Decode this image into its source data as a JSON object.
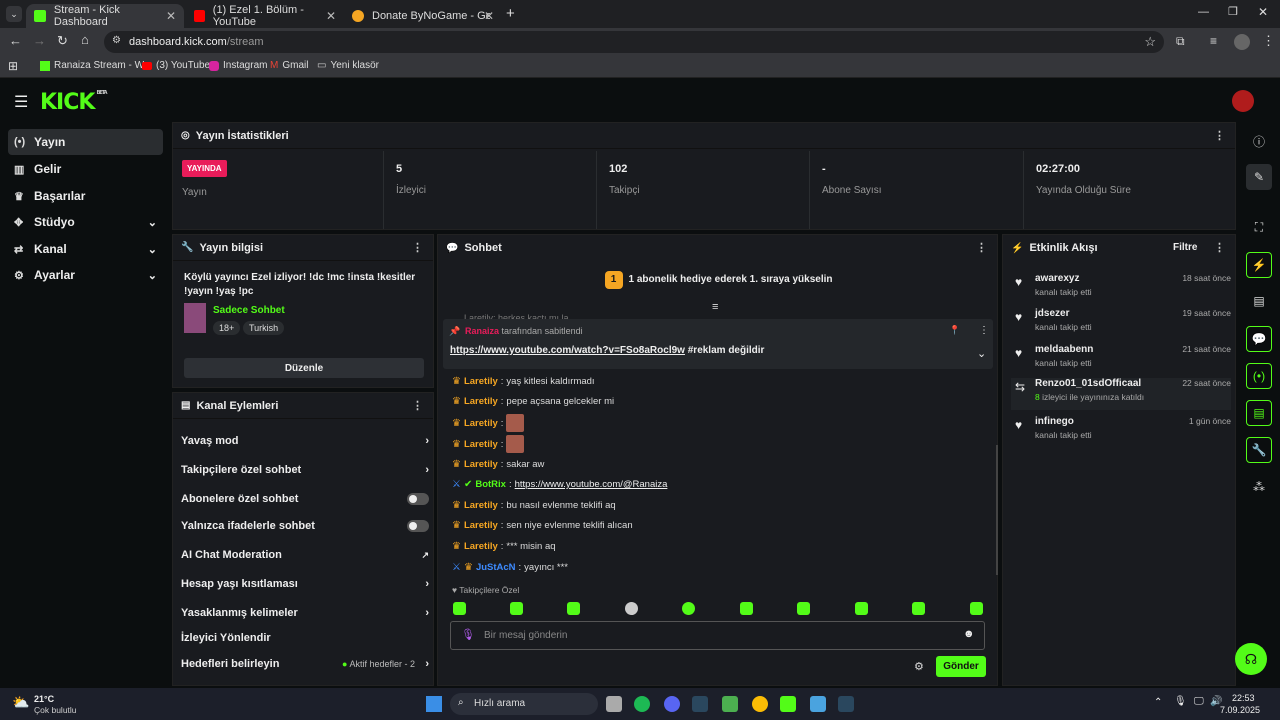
{
  "browser": {
    "tabs": [
      {
        "label": "Stream - Kick Dashboard",
        "active": true
      },
      {
        "label": "(1) Ezel 1. Bölüm - YouTube",
        "active": false
      },
      {
        "label": "Donate ByNoGame - Gelen/Gi",
        "active": false
      }
    ],
    "url_host": "dashboard.kick.com",
    "url_path": "/stream",
    "bookmarks": [
      "Ranaiza Stream - W...",
      "(3) YouTube",
      "Instagram",
      "Gmail",
      "Yeni klasör"
    ]
  },
  "brand": {
    "logo": "KICK",
    "beta": "BETA",
    "accent": "#53fc18"
  },
  "sidebar": {
    "items": [
      {
        "label": "Yayın",
        "icon": "broadcast-icon",
        "active": true,
        "chevron": false
      },
      {
        "label": "Gelir",
        "icon": "revenue-icon",
        "active": false,
        "chevron": false
      },
      {
        "label": "Başarılar",
        "icon": "trophy-icon",
        "active": false,
        "chevron": false
      },
      {
        "label": "Stüdyo",
        "icon": "studio-icon",
        "active": false,
        "chevron": true
      },
      {
        "label": "Kanal",
        "icon": "channel-icon",
        "active": false,
        "chevron": true
      },
      {
        "label": "Ayarlar",
        "icon": "gear-icon",
        "active": false,
        "chevron": true
      }
    ]
  },
  "stats": {
    "title": "Yayın İstatistikleri",
    "live_badge": "YAYINDA",
    "live_label": "Yayın",
    "items": [
      {
        "value": "5",
        "label": "İzleyici"
      },
      {
        "value": "102",
        "label": "Takipçi"
      },
      {
        "value": "-",
        "label": "Abone Sayısı"
      },
      {
        "value": "02:27:00",
        "label": "Yayında Olduğu Süre"
      }
    ]
  },
  "stream_info": {
    "title": "Yayın bilgisi",
    "stream_title_line1": "Köylü yayıncı Ezel izliyor! !dc !mc !insta !kesitler",
    "stream_title_line2": "!yayın !yaş !pc",
    "category": "Sadece Sohbet",
    "tags": [
      "18+",
      "Turkish"
    ],
    "edit_button": "Düzenle"
  },
  "channel_actions": {
    "title": "Kanal Eylemleri",
    "items": [
      {
        "label": "Yavaş mod",
        "control": "chevron"
      },
      {
        "label": "Takipçilere özel sohbet",
        "control": "chevron"
      },
      {
        "label": "Abonelere özel sohbet",
        "control": "toggle"
      },
      {
        "label": "Yalnızca ifadelerle sohbet",
        "control": "toggle"
      },
      {
        "label": "AI Chat Moderation",
        "control": "external"
      },
      {
        "label": "Hesap yaşı kısıtlaması",
        "control": "chevron"
      },
      {
        "label": "Yasaklanmış kelimeler",
        "control": "chevron"
      },
      {
        "label": "İzleyici Yönlendir",
        "control": "none"
      },
      {
        "label": "Hedefleri belirleyin",
        "control": "chevron",
        "extra": "Aktif hedefler - 2"
      }
    ]
  },
  "chat": {
    "title": "Sohbet",
    "gift_banner": "1 abonelik hediye ederek 1. sıraya yükselin",
    "gift_rank": "1",
    "partial_top": "Laretily: herkes kaçtı mı la",
    "pinned": {
      "by": "Ranaiza",
      "by_suffix": "tarafından sabitlendi",
      "link": "https://www.youtube.com/watch?v=FSo8aRocl9w",
      "text": "#reklam değildir"
    },
    "messages": [
      {
        "user": "Laretily",
        "text": "yaş kitlesi kaldırmadı",
        "type": "text",
        "color": "orange"
      },
      {
        "user": "Laretily",
        "text": "pepe açsana gelcekler mi",
        "type": "text",
        "color": "orange"
      },
      {
        "user": "Laretily",
        "text": "",
        "type": "emote",
        "color": "orange"
      },
      {
        "user": "Laretily",
        "text": "",
        "type": "emote",
        "color": "orange"
      },
      {
        "user": "Laretily",
        "text": "sakar aw",
        "type": "text",
        "color": "orange"
      },
      {
        "user": "BotRix",
        "text": "https://www.youtube.com/@Ranaiza",
        "type": "link",
        "color": "green"
      },
      {
        "user": "Laretily",
        "text": "bu nasıl evlenme teklifi aq",
        "type": "text",
        "color": "orange"
      },
      {
        "user": "Laretily",
        "text": "sen niye evlenme teklifi alıcan",
        "type": "text",
        "color": "orange"
      },
      {
        "user": "Laretily",
        "text": "*** misin aq",
        "type": "text",
        "color": "orange"
      },
      {
        "user": "JuStAcN",
        "text": "yayıncı ***",
        "type": "text",
        "color": "blue"
      }
    ],
    "emote_section": "Takipçilere Özel",
    "input_placeholder": "Bir mesaj gönderin",
    "send_button": "Gönder"
  },
  "activity": {
    "title": "Etkinlik Akışı",
    "filter": "Filtre",
    "items": [
      {
        "name": "awarexyz",
        "sub": "kanalı takip etti",
        "time": "18 saat önce",
        "icon": "heart-icon"
      },
      {
        "name": "jdsezer",
        "sub": "kanalı takip etti",
        "time": "19 saat önce",
        "icon": "heart-icon"
      },
      {
        "name": "meldaabenn",
        "sub": "kanalı takip etti",
        "time": "21 saat önce",
        "icon": "heart-icon"
      },
      {
        "name": "Renzo01_01sdOfficaal",
        "sub_count": "8",
        "sub": "izleyici ile yayınınıza katıldı",
        "time": "22 saat önce",
        "icon": "raid-icon"
      },
      {
        "name": "infinego",
        "sub": "kanalı takip etti",
        "time": "1 gün önce",
        "icon": "heart-icon"
      }
    ]
  },
  "taskbar": {
    "weather_temp": "21°C",
    "weather_desc": "Çok bulutlu",
    "search": "Hızlı arama",
    "time": "22:53",
    "date": "7.09.2025"
  }
}
